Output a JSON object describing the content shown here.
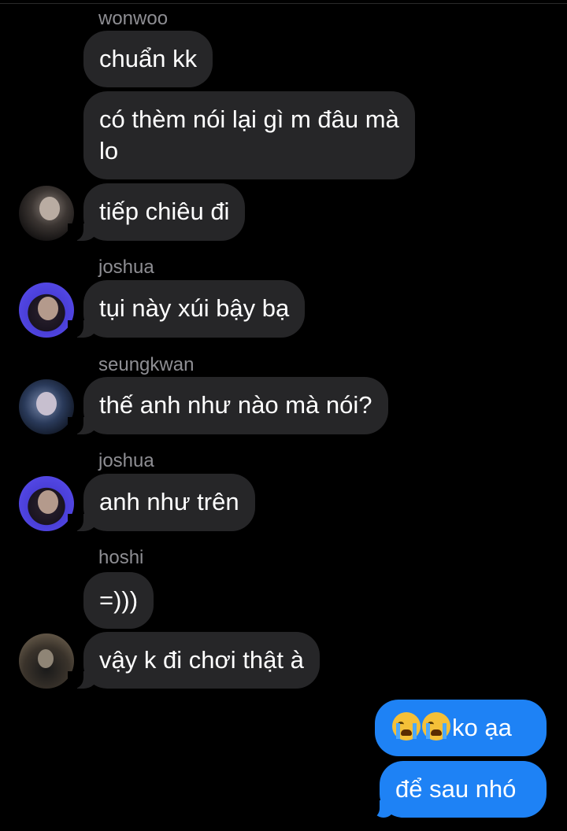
{
  "messages": {
    "name_wonwoo": "wonwoo",
    "m1": "chuẩn kk",
    "m2": "có thèm nói lại gì m đâu mà lo",
    "m3": "tiếp chiêu đi",
    "name_joshua_1": "joshua",
    "m4": "tụi này xúi bậy bạ",
    "name_seungkwan": "seungkwan",
    "m5": "thế anh như nào mà nói?",
    "name_joshua_2": "joshua",
    "m6": "anh như trên",
    "name_hoshi": "hoshi",
    "m7": "=)))",
    "m8": "vậy k đi chơi thật à",
    "me1_text": "ko ạa",
    "me2": "để sau nhó"
  },
  "icons": {
    "emoji": "loudly-crying-face-icon"
  },
  "colors": {
    "incoming_bubble": "#262628",
    "outgoing_bubble": "#1e82f5",
    "sender_name": "#8e8e93"
  }
}
